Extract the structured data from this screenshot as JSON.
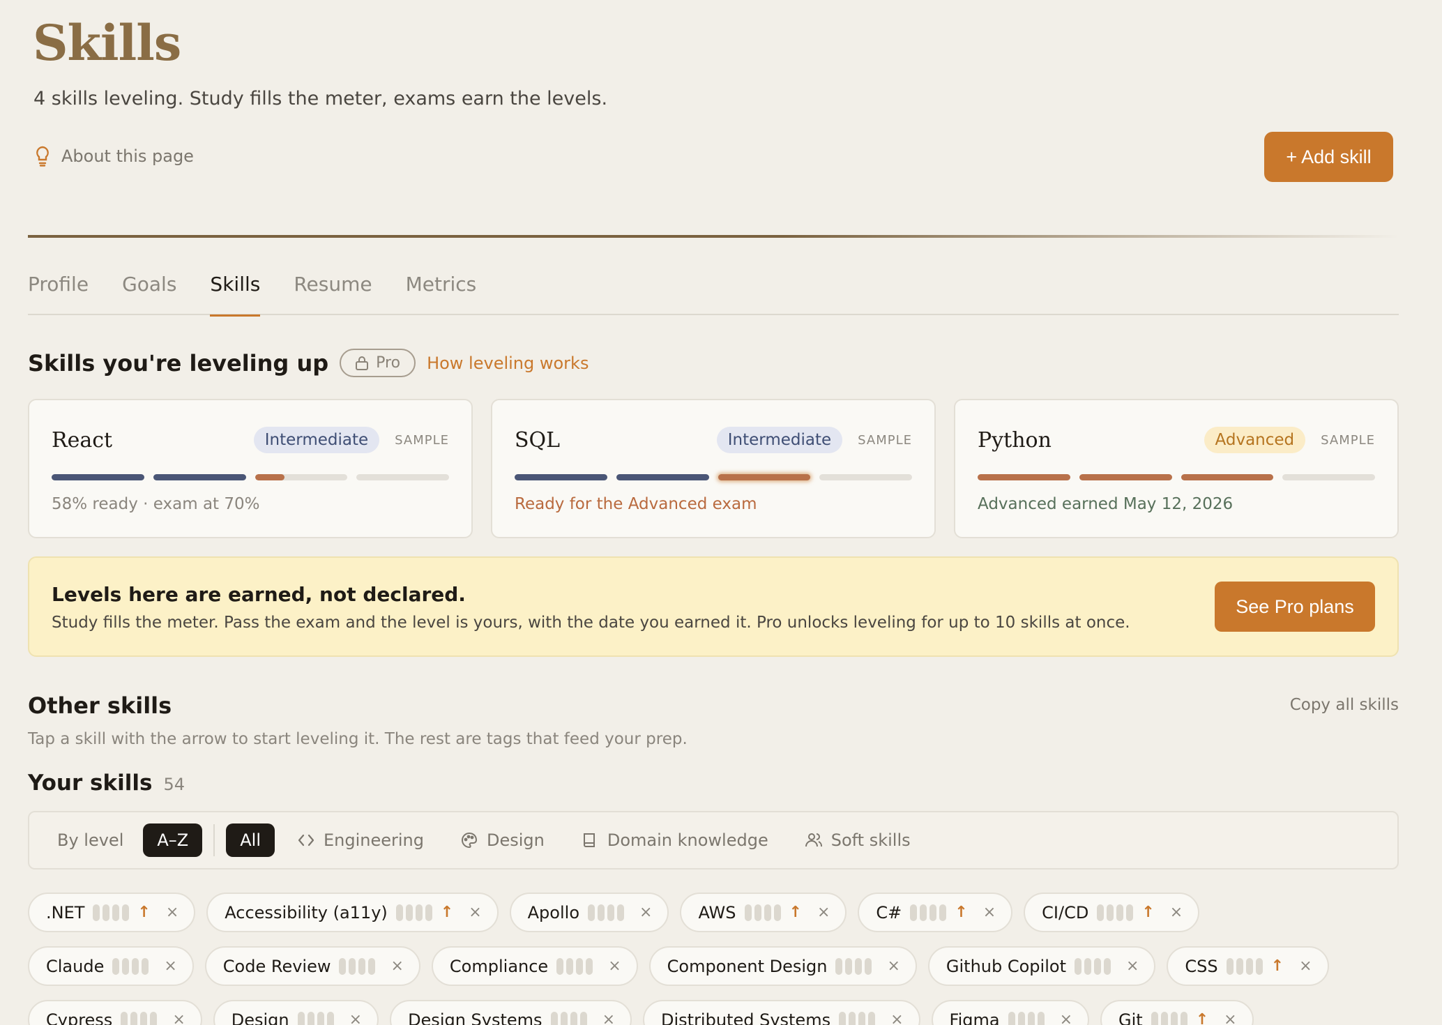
{
  "header": {
    "title": "Skills",
    "subtitle": "4 skills leveling. Study fills the meter, exams earn the levels.",
    "about_label": "About this page",
    "add_skill_label": "+ Add skill"
  },
  "tabs": [
    {
      "label": "Profile",
      "active": false
    },
    {
      "label": "Goals",
      "active": false
    },
    {
      "label": "Skills",
      "active": true
    },
    {
      "label": "Resume",
      "active": false
    },
    {
      "label": "Metrics",
      "active": false
    }
  ],
  "leveling": {
    "title": "Skills you're leveling up",
    "pro_label": "Pro",
    "how_label": "How leveling works",
    "cards": [
      {
        "name": "React",
        "level": "Intermediate",
        "tag": "SAMPLE",
        "status": "58% ready · exam at 70%"
      },
      {
        "name": "SQL",
        "level": "Intermediate",
        "tag": "SAMPLE",
        "status": "Ready for the Advanced exam"
      },
      {
        "name": "Python",
        "level": "Advanced",
        "tag": "SAMPLE",
        "status": "Advanced earned May 12, 2026"
      }
    ],
    "react_progress": 0.58
  },
  "banner": {
    "title": "Levels here are earned, not declared.",
    "text": "Study fills the meter. Pass the exam and the level is yours, with the date you earned it. Pro unlocks leveling for up to 10 skills at once.",
    "button_label": "See Pro plans"
  },
  "other": {
    "title": "Other skills",
    "copy_label": "Copy all skills",
    "subtitle": "Tap a skill with the arrow to start leveling it. The rest are tags that feed your prep.",
    "your_title": "Your skills",
    "your_count": "54"
  },
  "filters": {
    "by_level": "By level",
    "az": "A–Z",
    "all": "All",
    "engineering": "Engineering",
    "design": "Design",
    "domain": "Domain knowledge",
    "soft": "Soft skills"
  },
  "chips": [
    [
      ".NET",
      "Accessibility (a11y)",
      "Apollo",
      "AWS",
      "C#",
      "CI/CD"
    ],
    [
      "Claude",
      "Code Review",
      "Compliance",
      "Component Design",
      "Github Copilot",
      "CSS"
    ],
    [
      "Cypress",
      "Design",
      "Design Systems",
      "Distributed Systems",
      "Figma",
      "Git"
    ]
  ],
  "chip_arrows": [
    [
      true,
      true,
      false,
      true,
      true,
      true
    ],
    [
      false,
      false,
      false,
      false,
      false,
      true
    ],
    [
      false,
      false,
      false,
      false,
      false,
      true
    ]
  ],
  "colors": {
    "accent": "#c9782c",
    "title": "#8a6d45",
    "navy": "#4a5676",
    "copper": "#b8714a",
    "banner": "#fcf1c7"
  }
}
